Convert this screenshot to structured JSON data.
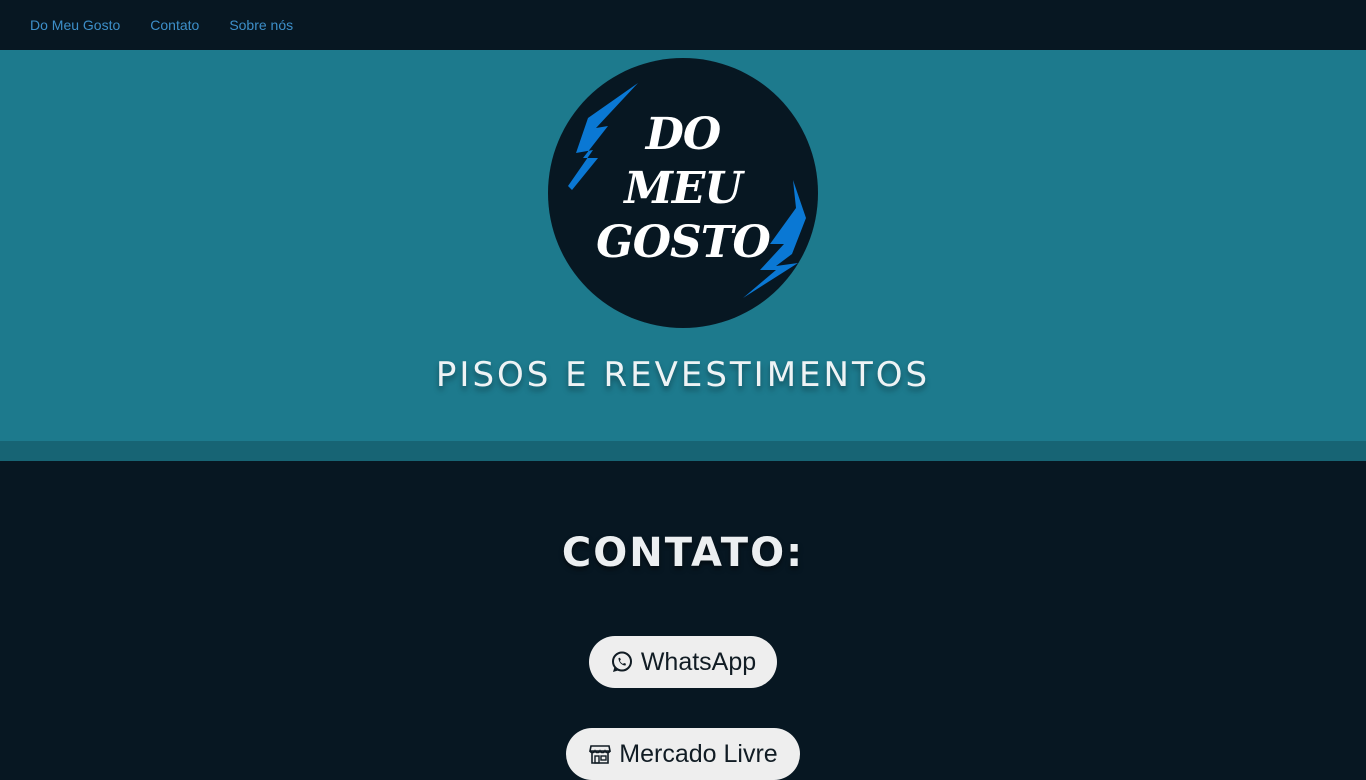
{
  "nav": {
    "items": [
      {
        "label": "Do Meu Gosto"
      },
      {
        "label": "Contato"
      },
      {
        "label": "Sobre nós"
      }
    ]
  },
  "logo": {
    "lines": [
      "DO",
      "MEU",
      "GOSTO"
    ]
  },
  "hero": {
    "tagline": "PISOS E REVESTIMENTOS"
  },
  "contact": {
    "title": "CONTATO:",
    "buttons": [
      {
        "label": "WhatsApp",
        "icon": "whatsapp-icon"
      },
      {
        "label": "Mercado Livre",
        "icon": "store-icon"
      }
    ]
  },
  "colors": {
    "nav_bg": "#071722",
    "hero_bg": "#1d7a8d",
    "link": "#3d8fc9",
    "bolt": "#0a78d4",
    "pill_bg": "#eeeeee"
  }
}
